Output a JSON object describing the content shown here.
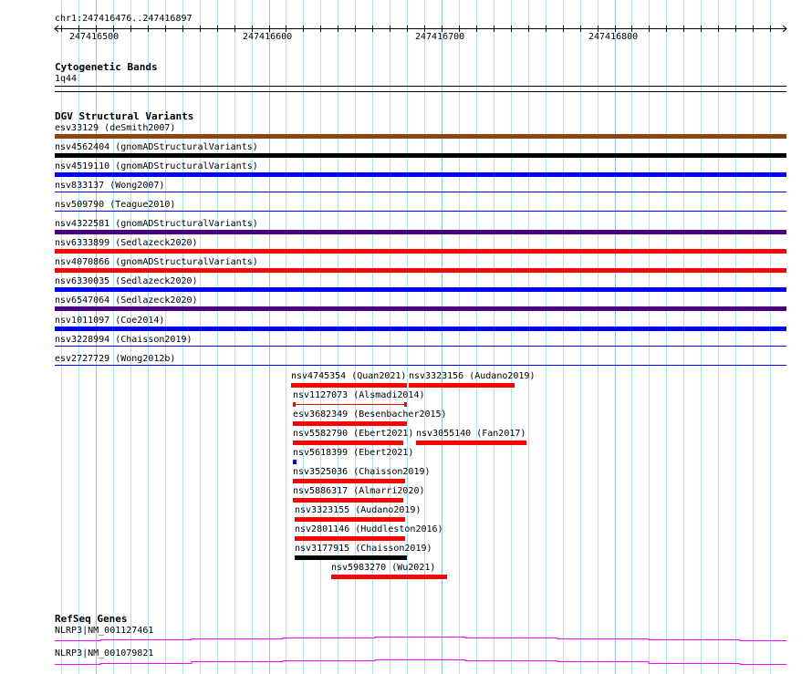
{
  "ruler": {
    "location": "chr1:247416476..247416897",
    "view_start": 247416476,
    "view_end": 247416897,
    "tick_labels": [
      "247416500",
      "247416600",
      "247416700",
      "247416800"
    ]
  },
  "cytoband": {
    "title": "Cytogenetic Bands",
    "band": "1q44"
  },
  "dgv": {
    "title": "DGV Structural Variants",
    "rows": [
      {
        "label": "esv33129 (deSmith2007)",
        "color": "#8b4513",
        "style": "bar"
      },
      {
        "label": "nsv4562404 (gnomADStructuralVariants)",
        "color": "#000000",
        "style": "bar"
      },
      {
        "label": "nsv4519110 (gnomADStructuralVariants)",
        "color": "#0000ff",
        "style": "bar"
      },
      {
        "label": "nsv833137 (Wong2007)",
        "color": "#0000ff",
        "style": "thin"
      },
      {
        "label": "nsv509790 (Teague2010)",
        "color": "#0000ff",
        "style": "thin"
      },
      {
        "label": "nsv4322581 (gnomADStructuralVariants)",
        "color": "#4b0082",
        "style": "bar"
      },
      {
        "label": "nsv6333899 (Sedlazeck2020)",
        "color": "#ff0000",
        "style": "bar"
      },
      {
        "label": "nsv4070866 (gnomADStructuralVariants)",
        "color": "#ff0000",
        "style": "bar"
      },
      {
        "label": "nsv6330035 (Sedlazeck2020)",
        "color": "#0000ff",
        "style": "bar"
      },
      {
        "label": "nsv6547064 (Sedlazeck2020)",
        "color": "#4b0082",
        "style": "bar"
      },
      {
        "label": "nsv1011097 (Coe2014)",
        "color": "#0000ff",
        "style": "bar"
      },
      {
        "label": "nsv3228994 (Chaisson2019)",
        "color": "#0000ff",
        "style": "thin"
      },
      {
        "label": "esv2727729 (Wong2012b)",
        "color": "#0000ff",
        "style": "thin"
      }
    ],
    "features": [
      {
        "label": "nsv4745354 (Quan2021)",
        "start": 247416613,
        "end": 247416680,
        "row": 0,
        "color": "#ff0000"
      },
      {
        "label": "nsv3323156 (Audano2019)",
        "start": 247416681,
        "end": 247416742,
        "row": 0,
        "color": "#ff0000"
      },
      {
        "label": "nsv1127073 (Alsmadi2014)",
        "start": 247416614,
        "end": 247416680,
        "row": 1,
        "color": "#ff0000",
        "style": "dumbbell"
      },
      {
        "label": "esv3682349 (Besenbacher2015)",
        "start": 247416614,
        "end": 247416680,
        "row": 2,
        "color": "#ff0000"
      },
      {
        "label": "nsv5582790 (Ebert2021)",
        "start": 247416614,
        "end": 247416678,
        "row": 3,
        "color": "#ff0000"
      },
      {
        "label": "nsv3055140 (Fan2017)",
        "start": 247416685,
        "end": 247416749,
        "row": 3,
        "color": "#ff0000"
      },
      {
        "label": "nsv5618399 (Ebert2021)",
        "start": 247416614,
        "end": 247416616,
        "row": 4,
        "color": "#0000ff"
      },
      {
        "label": "nsv3525036 (Chaisson2019)",
        "start": 247416614,
        "end": 247416679,
        "row": 5,
        "color": "#ff0000"
      },
      {
        "label": "nsv5886317 (Almarri2020)",
        "start": 247416614,
        "end": 247416678,
        "row": 6,
        "color": "#ff0000"
      },
      {
        "label": "nsv3323155 (Audano2019)",
        "start": 247416615,
        "end": 247416679,
        "row": 7,
        "color": "#ff0000"
      },
      {
        "label": "nsv2801146 (Huddleston2016)",
        "start": 247416615,
        "end": 247416679,
        "row": 8,
        "color": "#ff0000"
      },
      {
        "label": "nsv3177915 (Chaisson2019)",
        "start": 247416615,
        "end": 247416680,
        "row": 9,
        "color": "#000000"
      },
      {
        "label": "nsv5983270 (Wu2021)",
        "start": 247416636,
        "end": 247416703,
        "row": 10,
        "color": "#ff0000"
      }
    ]
  },
  "refseq": {
    "title": "RefSeq Genes",
    "genes": [
      {
        "label": "NLRP3|NM_001127461",
        "color": "#ff00ff"
      },
      {
        "label": "NLRP3|NM_001079821",
        "color": "#ff00ff"
      }
    ]
  }
}
